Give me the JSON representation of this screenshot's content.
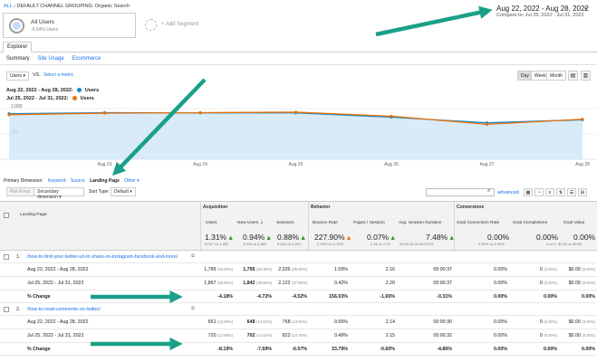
{
  "breadcrumb": {
    "all": "ALL",
    "path": "DEFAULT CHANNEL GROUPING: Organic Search"
  },
  "segment": {
    "name": "All Users",
    "sub": "-0.64% Users",
    "add": "+ Add Segment"
  },
  "date_range": {
    "main": "Aug 22, 2022 - Aug 28, 2022",
    "compare_label": "Compare to:",
    "compare": "Jul 25, 2022 - Jul 31, 2022"
  },
  "tabs": {
    "explorer": "Explorer",
    "summary": "Summary",
    "site_usage": "Site Usage",
    "ecommerce": "Ecommerce"
  },
  "controls": {
    "metric": "Users",
    "vs": "VS.",
    "select_metric": "Select a metric",
    "day": "Day",
    "week": "Week",
    "month": "Month"
  },
  "legend": [
    {
      "range": "Aug 22, 2022 - Aug 28, 2022:",
      "label": "Users",
      "color": "#1e88c8"
    },
    {
      "range": "Jul 25, 2022 - Jul 31, 2022:",
      "label": "Users",
      "color": "#e8710a"
    }
  ],
  "chart_data": {
    "type": "line",
    "x": [
      "Aug 22",
      "Aug 23",
      "Aug 24",
      "Aug 25",
      "Aug 26",
      "Aug 27",
      "Aug 28"
    ],
    "x_ticks": [
      "Aug 23",
      "Aug 24",
      "Aug 25",
      "Aug 26",
      "Aug 27",
      "Aug 28"
    ],
    "y_ticks": [
      "1,000",
      "500"
    ],
    "ylim": [
      0,
      1000
    ],
    "series": [
      {
        "name": "Users",
        "color": "#1e88c8",
        "values": [
          900,
          920,
          915,
          915,
          830,
          720,
          780
        ]
      },
      {
        "name": "Users",
        "color": "#e8710a",
        "values": [
          880,
          910,
          920,
          930,
          850,
          690,
          790
        ]
      }
    ]
  },
  "primary_dimension": {
    "label": "Primary Dimension:",
    "keyword": "Keyword",
    "source": "Source",
    "landing_page": "Landing Page",
    "other": "Other"
  },
  "toolbar": {
    "plot_rows": "Plot Rows",
    "secondary": "Secondary dimension",
    "sort_type": "Sort Type:",
    "default": "Default",
    "advanced": "advanced"
  },
  "table": {
    "groups": {
      "acquisition": "Acquisition",
      "behavior": "Behavior",
      "conversions": "Conversions"
    },
    "dimension_header": "Landing Page",
    "columns": [
      "Users",
      "New Users",
      "Sessions",
      "Bounce Rate",
      "Pages / Session",
      "Avg. Session Duration",
      "Goal Conversion Rate",
      "Goal Completions",
      "Goal Value"
    ],
    "totals": [
      {
        "v": "1.31%",
        "s": "5,017 vs 4,952"
      },
      {
        "v": "0.94%",
        "s": "4,929 vs 4,883"
      },
      {
        "v": "0.88%",
        "s": "5,640 vs 5,591"
      },
      {
        "v": "227.90%",
        "s": "2.29% vs 0.70%"
      },
      {
        "v": "0.07%",
        "s": "2.16 vs 2.16"
      },
      {
        "v": "7.48%",
        "s": "00:00:35 vs 00:00:33"
      },
      {
        "v": "0.00%",
        "s": "0.00% vs 0.00%"
      },
      {
        "v": "0.00%",
        "s": "0 vs 0"
      },
      {
        "v": "0.00%",
        "s": "$0.00 vs $0.00"
      }
    ],
    "rows": [
      {
        "num": "1.",
        "page": "/how-to-find-your-twitter-url-to-share-on-instagram-facebook-and-more/",
        "lines": [
          {
            "label": "Aug 22, 2022 - Aug 28, 2022",
            "users": "1,789",
            "users_p": "(34.06%)",
            "new": "1,755",
            "new_p": "(36.38%)",
            "sess": "2,026",
            "sess_p": "(35.92%)",
            "br": "1.09%",
            "pps": "2.16",
            "dur": "00:00:37",
            "gcr": "0.00%",
            "gc": "0",
            "gc_p": "(0.00%)",
            "gv": "$0.00",
            "gv_p": "(0.00%)"
          },
          {
            "label": "Jul 25, 2022 - Jul 31, 2022",
            "users": "1,867",
            "users_p": "(38.05%)",
            "new": "1,842",
            "new_p": "(38.58%)",
            "sess": "2,122",
            "sess_p": "(37.95%)",
            "br": "0.42%",
            "pps": "2.20",
            "dur": "00:00:37",
            "gcr": "0.00%",
            "gc": "0",
            "gc_p": "(0.00%)",
            "gv": "$0.00",
            "gv_p": "(0.00%)"
          },
          {
            "label": "% Change",
            "users": "-4.18%",
            "new": "-4.72%",
            "sess": "-4.52%",
            "br": "156.03%",
            "pps": "-1.65%",
            "dur": "-0.31%",
            "gcr": "0.00%",
            "gc": "0.00%",
            "gv": "0.00%"
          }
        ]
      },
      {
        "num": "2.",
        "page": "/how-to-read-comments-on-twitter/",
        "lines": [
          {
            "label": "Aug 22, 2022 - Aug 28, 2022",
            "users": "661",
            "users_p": "(12.59%)",
            "new": "648",
            "new_p": "(13.42%)",
            "sess": "768",
            "sess_p": "(13.62%)",
            "br": "0.65%",
            "pps": "2.14",
            "dur": "00:00:30",
            "gcr": "0.00%",
            "gc": "0",
            "gc_p": "(0.00%)",
            "gv": "$0.00",
            "gv_p": "(0.00%)"
          },
          {
            "label": "Jul 25, 2022 - Jul 31, 2022",
            "users": "720",
            "users_p": "(13.88%)",
            "new": "702",
            "new_p": "(14.44%)",
            "sess": "822",
            "sess_p": "(14.70%)",
            "br": "0.49%",
            "pps": "2.15",
            "dur": "00:00:32",
            "gcr": "0.00%",
            "gc": "0",
            "gc_p": "(0.00%)",
            "gv": "$0.00",
            "gv_p": "(0.00%)"
          },
          {
            "label": "% Change",
            "users": "-8.19%",
            "new": "-7.69%",
            "sess": "-6.57%",
            "br": "33.79%",
            "pps": "-0.60%",
            "dur": "-4.86%",
            "gcr": "0.00%",
            "gc": "0.00%",
            "gv": "0.00%"
          }
        ]
      }
    ]
  }
}
